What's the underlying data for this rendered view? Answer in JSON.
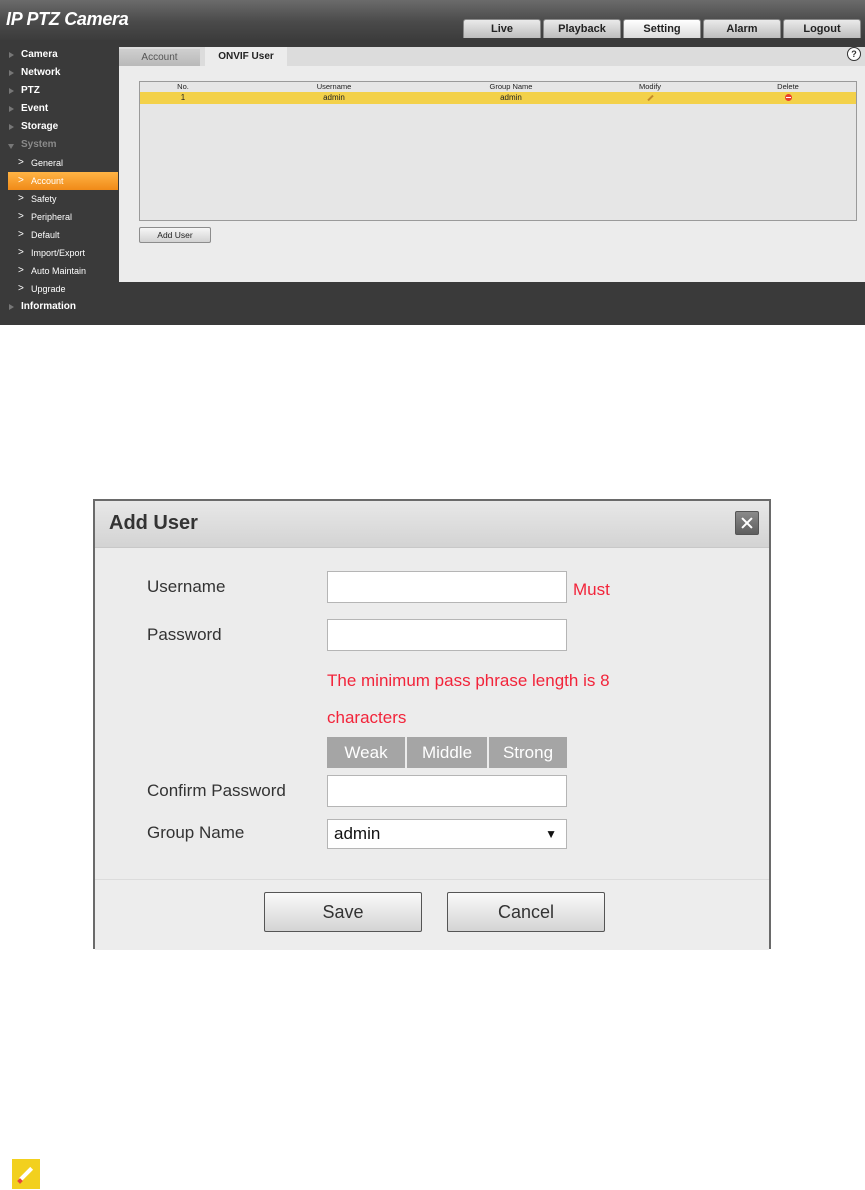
{
  "app": {
    "title": "IP PTZ Camera",
    "top_tabs": [
      "Live",
      "Playback",
      "Setting",
      "Alarm",
      "Logout"
    ],
    "active_top_tab": "Setting",
    "sidebar": {
      "sections_top": [
        "Camera",
        "Network",
        "PTZ",
        "Event",
        "Storage",
        "System"
      ],
      "system_items": [
        "General",
        "Account",
        "Safety",
        "Peripheral",
        "Default",
        "Import/Export",
        "Auto Maintain",
        "Upgrade"
      ],
      "active_item": "Account",
      "sections_bottom": [
        "Information"
      ]
    },
    "content_tabs": [
      "Account",
      "ONVIF User"
    ],
    "active_content_tab": "ONVIF User",
    "help_glyph": "?",
    "table": {
      "headers": [
        "No.",
        "Username",
        "Group Name",
        "Modify",
        "Delete"
      ],
      "rows": [
        {
          "no": "1",
          "username": "admin",
          "group": "admin"
        }
      ]
    },
    "add_user_label": "Add User"
  },
  "dialog": {
    "title": "Add User",
    "username_label": "Username",
    "username_value": "",
    "must_label": "Must",
    "password_label": "Password",
    "password_value": "",
    "password_hint_line1": "The minimum pass phrase length is 8",
    "password_hint_line2": "characters",
    "strength_levels": [
      "Weak",
      "Middle",
      "Strong"
    ],
    "confirm_label": "Confirm Password",
    "confirm_value": "",
    "group_label": "Group Name",
    "group_value": "admin",
    "save_label": "Save",
    "cancel_label": "Cancel"
  },
  "colors": {
    "accent_orange": "#f08a18",
    "row_highlight": "#f3d14a",
    "warning_red": "#f2243a",
    "note_yellow": "#f2d01e"
  },
  "icons": {
    "help": "help-icon",
    "modify": "pencil-icon",
    "delete": "delete-icon",
    "close": "close-icon",
    "dropdown": "chevron-down-icon",
    "note": "note-pencil-icon"
  }
}
